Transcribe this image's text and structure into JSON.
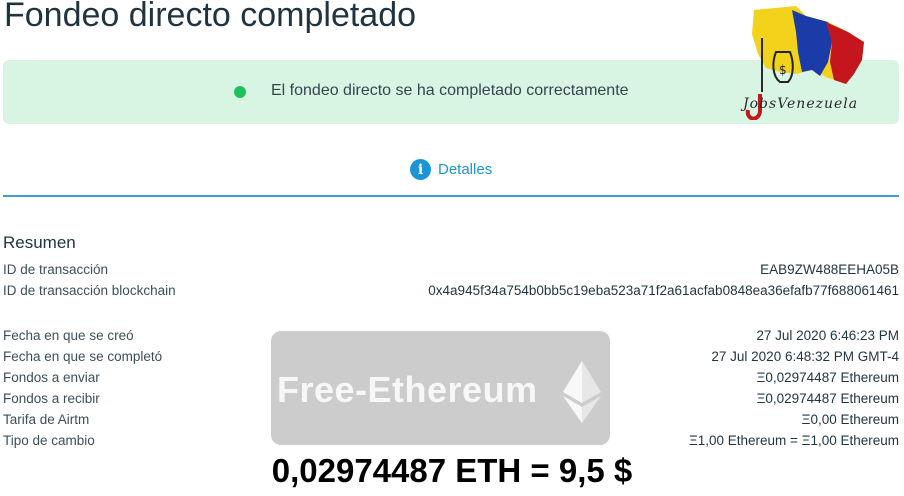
{
  "page": {
    "title": "Fondeo directo completado"
  },
  "banner": {
    "message": "El fondeo directo se ha completado correctamente",
    "status_color": "#1ec15b"
  },
  "logo": {
    "text": "JobsVenezuela"
  },
  "tabs": {
    "details": "Detalles",
    "details_icon": "info-icon"
  },
  "summary": {
    "title": "Resumen",
    "rows": [
      {
        "label": "ID de transacción",
        "value": "EAB9ZW488EEHA05B"
      },
      {
        "label": "ID de transacción blockchain",
        "value": "0x4a945f34a754b0bb5c19eba523a71f2a61acfab0848ea36efafb77f688061461"
      },
      {
        "label": "Fecha en que se creó",
        "value": "27 Jul 2020 6:46:23 PM"
      },
      {
        "label": "Fecha en que se completó",
        "value": "27 Jul 2020 6:48:32 PM GMT-4"
      },
      {
        "label": "Fondos a enviar",
        "value": "Ξ0,02974487 Ethereum"
      },
      {
        "label": "Fondos a recibir",
        "value": "Ξ0,02974487 Ethereum"
      },
      {
        "label": "Tarifa de Airtm",
        "value": "Ξ0,00 Ethereum"
      },
      {
        "label": "Tipo de cambio",
        "value": "Ξ1,00 Ethereum = Ξ1,00 Ethereum"
      }
    ]
  },
  "watermark": {
    "text": "Free-Ethereum"
  },
  "overlay": {
    "caption": "0,02974487 ETH = 9,5 $"
  },
  "colors": {
    "accent": "#1b95d6",
    "banner_bg": "#d8f5e4"
  }
}
